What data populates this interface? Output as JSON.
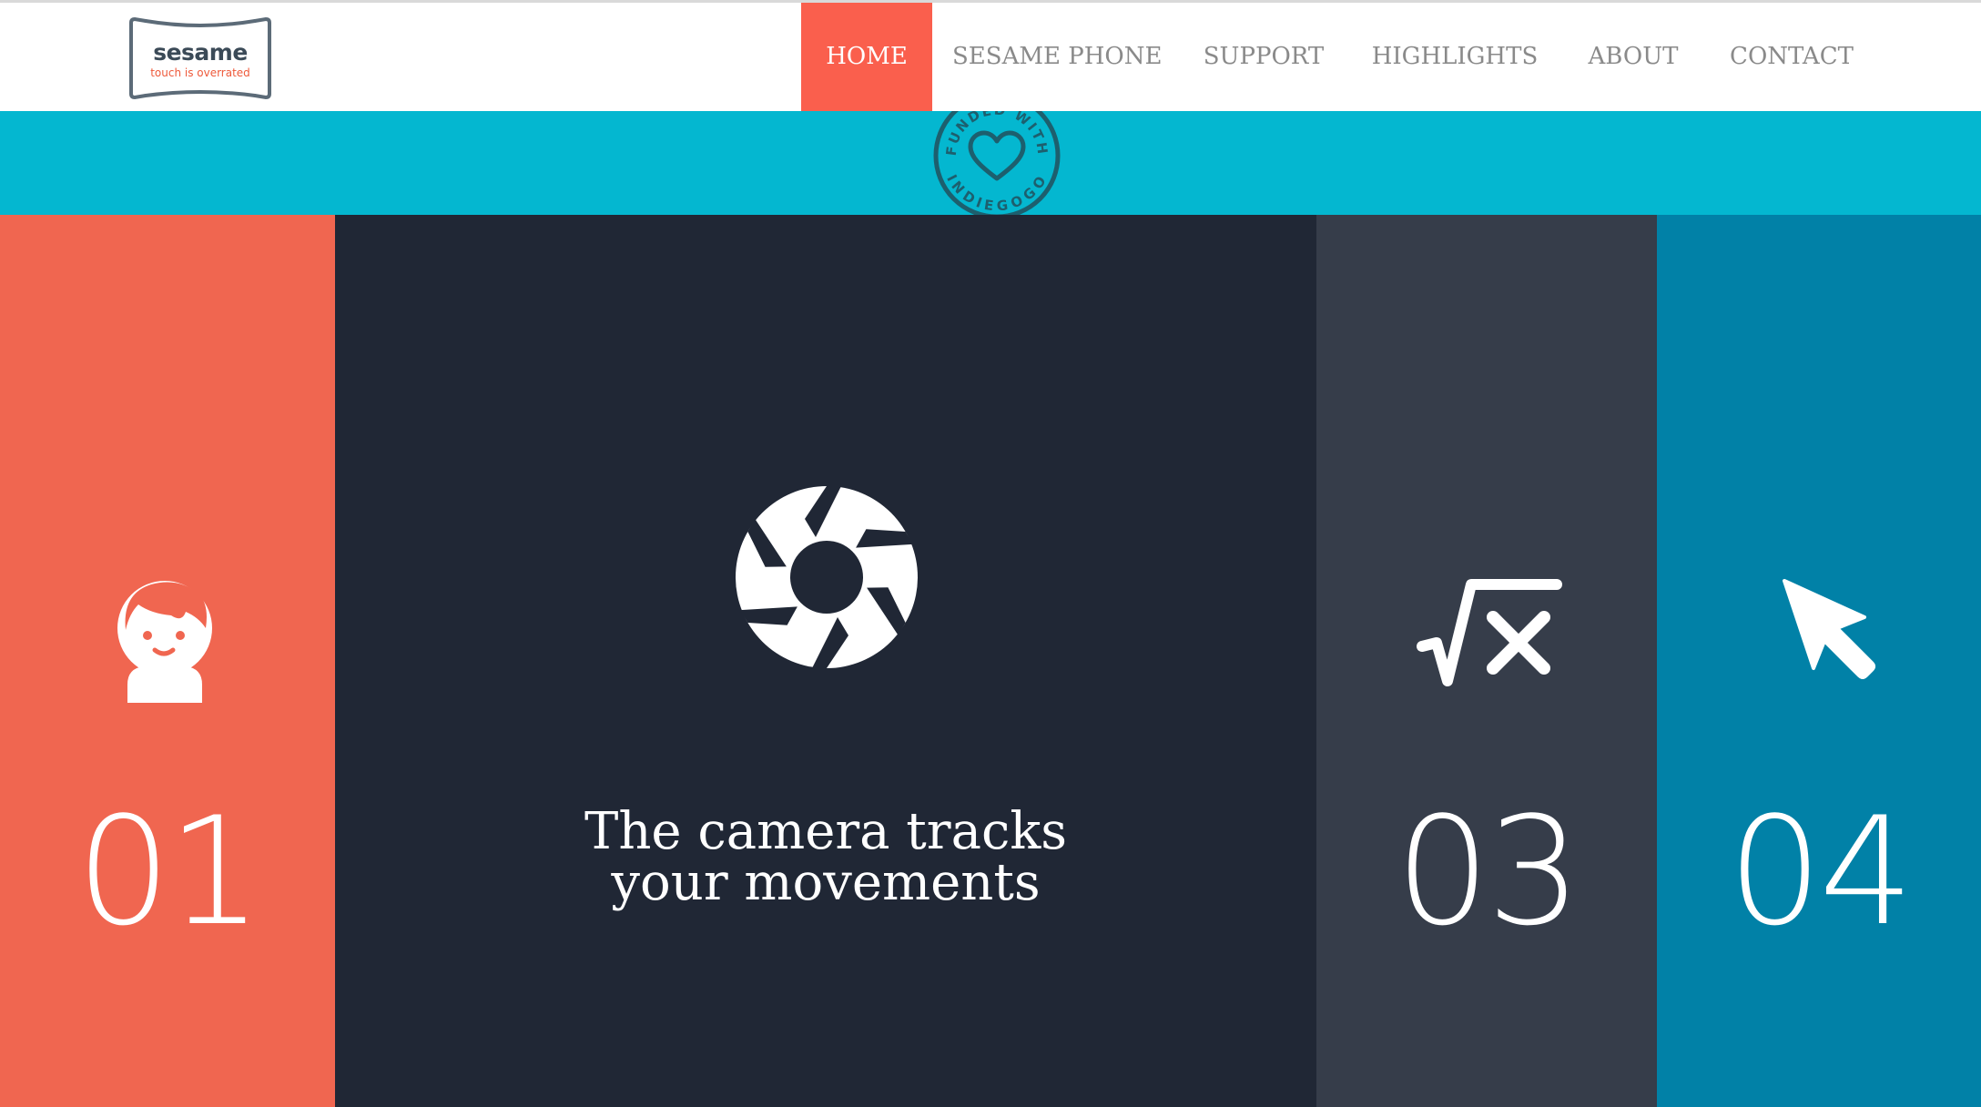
{
  "logo": {
    "name": "sesame",
    "tagline": "touch is overrated"
  },
  "nav": {
    "items": [
      {
        "label": "HOME",
        "active": true
      },
      {
        "label": "SESAME PHONE",
        "active": false
      },
      {
        "label": "SUPPORT",
        "active": false
      },
      {
        "label": "HIGHLIGHTS",
        "active": false
      },
      {
        "label": "ABOUT",
        "active": false
      },
      {
        "label": "CONTACT",
        "active": false
      }
    ]
  },
  "banner": {
    "badge_text_top": "FUNDED WITH",
    "badge_text_bottom": "INDIEGOGO",
    "badge_icon": "heart-icon"
  },
  "panels": [
    {
      "number": "01",
      "icon": "face-icon"
    },
    {
      "icon": "camera-aperture-icon",
      "caption_line1": "The camera tracks",
      "caption_line2": "your movements"
    },
    {
      "number": "03",
      "icon": "square-root-x-icon"
    },
    {
      "number": "04",
      "icon": "cursor-arrow-icon"
    }
  ],
  "colors": {
    "nav_active": "#fa5f4d",
    "banner": "#04b7d0",
    "panel1": "#f06650",
    "panel2": "#202735",
    "panel3": "#363d4a",
    "panel4": "#0181a7"
  }
}
